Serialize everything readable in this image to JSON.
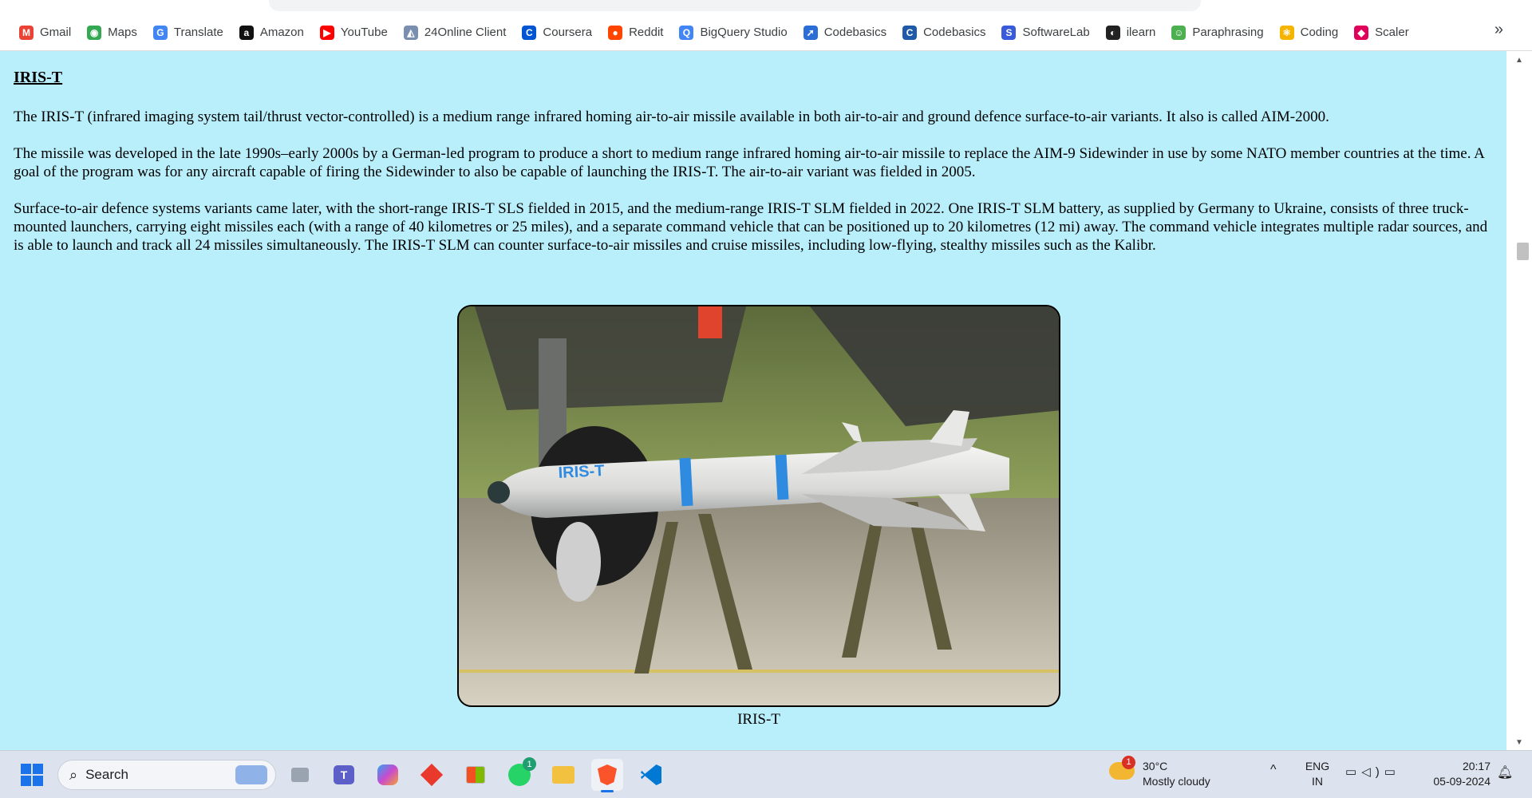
{
  "bookmarks": [
    {
      "label": "Gmail",
      "icon": "gmail-icon",
      "color": "#ea4335",
      "glyph": "M"
    },
    {
      "label": "Maps",
      "icon": "maps-icon",
      "color": "#34a853",
      "glyph": "◉"
    },
    {
      "label": "Translate",
      "icon": "translate-icon",
      "color": "#4285f4",
      "glyph": "G"
    },
    {
      "label": "Amazon",
      "icon": "amazon-icon",
      "color": "#111111",
      "glyph": "a"
    },
    {
      "label": "YouTube",
      "icon": "youtube-icon",
      "color": "#ff0000",
      "glyph": "▶"
    },
    {
      "label": "24Online Client",
      "icon": "24online-icon",
      "color": "#7a8fb0",
      "glyph": "◭"
    },
    {
      "label": "Coursera",
      "icon": "coursera-icon",
      "color": "#0056d2",
      "glyph": "C"
    },
    {
      "label": "Reddit",
      "icon": "reddit-icon",
      "color": "#ff4500",
      "glyph": "●"
    },
    {
      "label": "BigQuery Studio",
      "icon": "bigquery-icon",
      "color": "#4285f4",
      "glyph": "Q"
    },
    {
      "label": "Codebasics",
      "icon": "rocket-icon",
      "color": "#2b6fd6",
      "glyph": "➚"
    },
    {
      "label": "Codebasics",
      "icon": "codebasics-icon",
      "color": "#1e5aa8",
      "glyph": "C"
    },
    {
      "label": "SoftwareLab",
      "icon": "softwarelab-icon",
      "color": "#3a5bd9",
      "glyph": "S"
    },
    {
      "label": "ilearn",
      "icon": "ilearn-icon",
      "color": "#222222",
      "glyph": "◐"
    },
    {
      "label": "Paraphrasing",
      "icon": "paraphrasing-icon",
      "color": "#4caf50",
      "glyph": "☺"
    },
    {
      "label": "Coding",
      "icon": "coding-icon",
      "color": "#f5b400",
      "glyph": "⚛"
    },
    {
      "label": "Scaler",
      "icon": "scaler-icon",
      "color": "#e0005a",
      "glyph": "◆"
    }
  ],
  "bookmarks_more": "»",
  "article": {
    "title": "IRIS-T",
    "paragraphs": [
      "The IRIS-T (infrared imaging system tail/thrust vector-controlled) is a medium range infrared homing air-to-air missile available in both air-to-air and ground defence surface-to-air variants. It also is called AIM-2000.",
      "The missile was developed in the late 1990s–early 2000s by a German-led program to produce a short to medium range infrared homing air-to-air missile to replace the AIM-9 Sidewinder in use by some NATO member countries at the time. A goal of the program was for any aircraft capable of firing the Sidewinder to also be capable of launching the IRIS-T. The air-to-air variant was fielded in 2005.",
      "Surface-to-air defence systems variants came later, with the short-range IRIS-T SLS fielded in 2015, and the medium-range IRIS-T SLM fielded in 2022. One IRIS-T SLM battery, as supplied by Germany to Ukraine, consists of three truck-mounted launchers, carrying eight missiles each (with a range of 40 kilometres or 25 miles), and a separate command vehicle that can be positioned up to 20 kilometres (12 mi) away. The command vehicle integrates multiple radar sources, and is able to launch and track all 24 missiles simultaneously. The IRIS-T SLM can counter surface-to-air missiles and cruise missiles, including low-flying, stealthy missiles such as the Kalibr."
    ],
    "image_caption": "IRIS-T",
    "missile_marking": "IRIS-T"
  },
  "taskbar": {
    "search_label": "Search",
    "whatsapp_badge": "1",
    "weather_badge": "1",
    "weather_temp": "30°C",
    "weather_desc": "Mostly cloudy",
    "lang_line1": "ENG",
    "lang_line2": "IN",
    "time": "20:17",
    "date": "05-09-2024"
  },
  "colors": {
    "page_bg": "#b9eefb",
    "taskbar_bg": "#dde3ee"
  }
}
